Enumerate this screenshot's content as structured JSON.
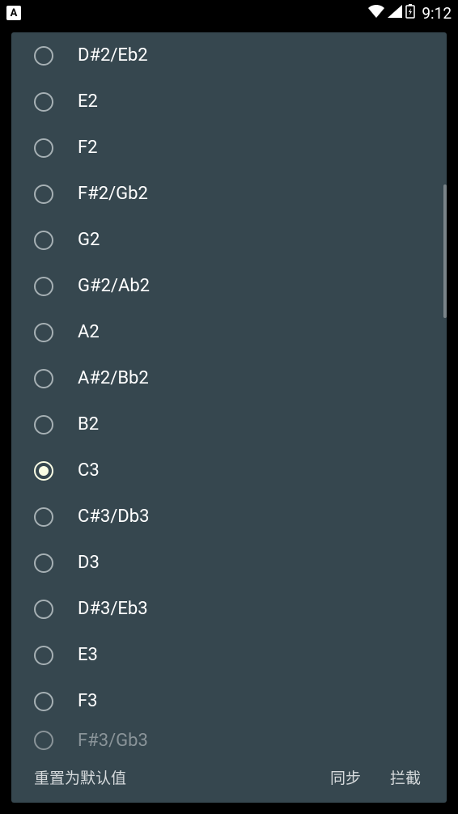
{
  "status_bar": {
    "app_badge": "A",
    "time": "9:12"
  },
  "notes": [
    {
      "id": "dsharp2",
      "label": "D#2/Eb2",
      "selected": false
    },
    {
      "id": "e2",
      "label": "E2",
      "selected": false
    },
    {
      "id": "f2",
      "label": "F2",
      "selected": false
    },
    {
      "id": "fsharp2",
      "label": "F#2/Gb2",
      "selected": false
    },
    {
      "id": "g2",
      "label": "G2",
      "selected": false
    },
    {
      "id": "gsharp2",
      "label": "G#2/Ab2",
      "selected": false
    },
    {
      "id": "a2",
      "label": "A2",
      "selected": false
    },
    {
      "id": "asharp2",
      "label": "A#2/Bb2",
      "selected": false
    },
    {
      "id": "b2",
      "label": "B2",
      "selected": false
    },
    {
      "id": "c3",
      "label": "C3",
      "selected": true
    },
    {
      "id": "csharp3",
      "label": "C#3/Db3",
      "selected": false
    },
    {
      "id": "d3",
      "label": "D3",
      "selected": false
    },
    {
      "id": "dsharp3",
      "label": "D#3/Eb3",
      "selected": false
    },
    {
      "id": "e3",
      "label": "E3",
      "selected": false
    },
    {
      "id": "f3",
      "label": "F3",
      "selected": false
    },
    {
      "id": "fsharp3",
      "label": "F#3/Gb3",
      "selected": false
    }
  ],
  "footer": {
    "reset": "重置为默认值",
    "sync": "同步",
    "intercept": "拦截"
  }
}
